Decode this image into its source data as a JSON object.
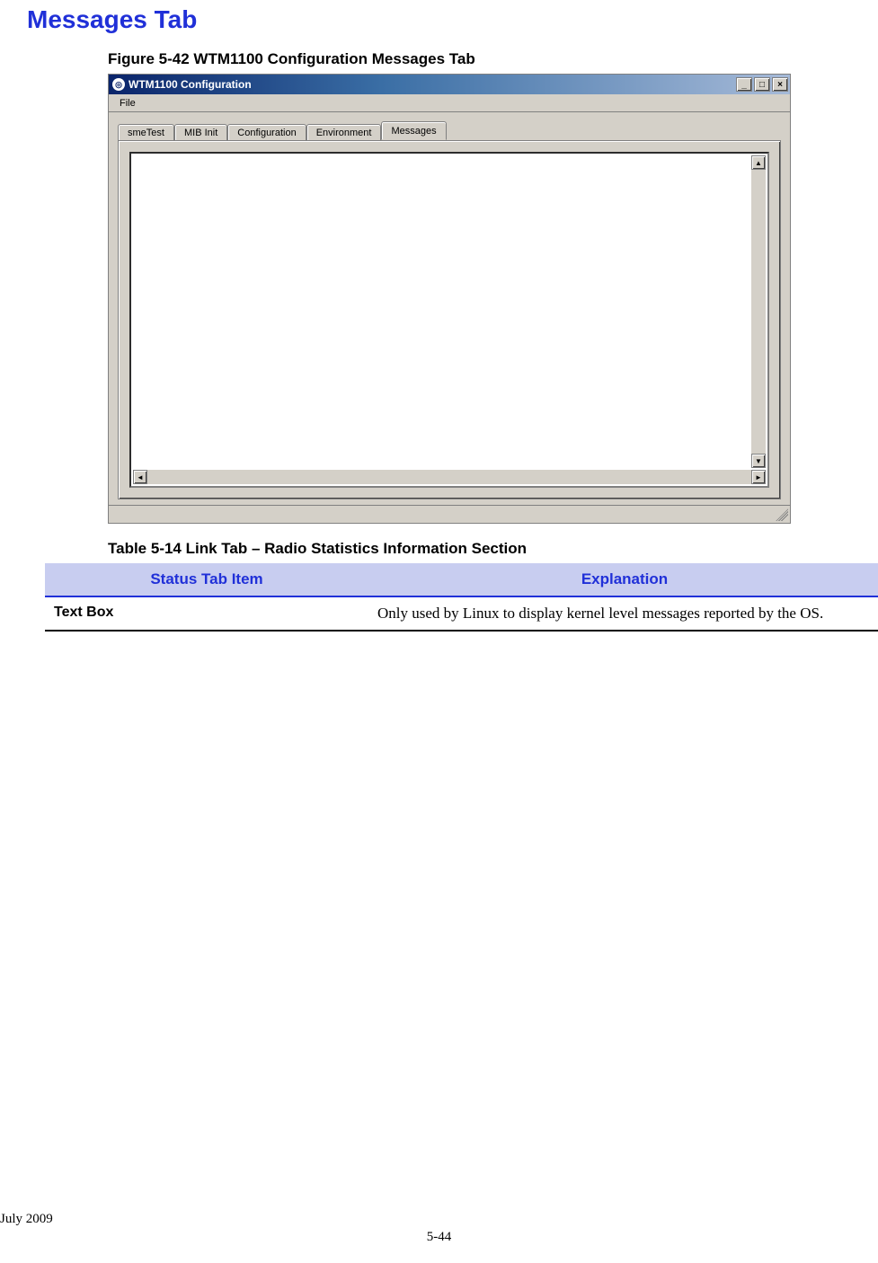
{
  "heading": "Messages Tab",
  "figure_caption": "Figure 5-42      WTM1100 Configuration Messages Tab",
  "window": {
    "title": "WTM1100 Configuration",
    "menu": {
      "file": "File"
    },
    "tabs": {
      "items": [
        {
          "label": "smeTest",
          "active": false
        },
        {
          "label": "MIB Init",
          "active": false
        },
        {
          "label": "Configuration",
          "active": false
        },
        {
          "label": "Environment",
          "active": false
        },
        {
          "label": "Messages",
          "active": true
        }
      ]
    }
  },
  "table_caption": "Table 5-14  Link Tab – Radio Statistics Information Section",
  "table": {
    "headers": {
      "col1": "Status Tab Item",
      "col2": "Explanation"
    },
    "rows": [
      {
        "item": "Text Box",
        "explanation": "Only used by Linux to display kernel level messages reported by the OS."
      }
    ]
  },
  "footer": {
    "date": "July 2009",
    "page": "5-44"
  }
}
